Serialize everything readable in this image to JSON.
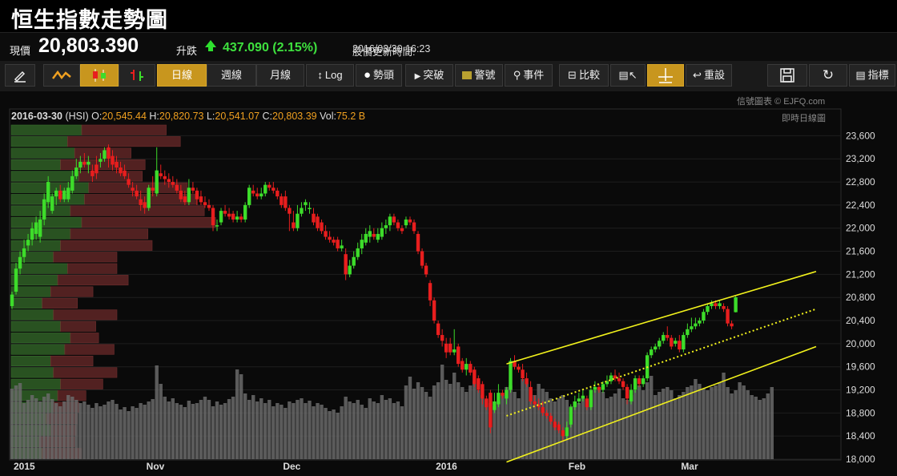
{
  "title": "恒生指數走勢圖",
  "quote": {
    "price_label": "現價",
    "price": "20,803.390",
    "change_label": "升跌",
    "change": "437.090 (2.15%)",
    "update_label": "股價更新時間:",
    "update_time": "2016/03/30 16:23"
  },
  "toolbar": {
    "daily": "日線",
    "weekly": "週線",
    "monthly": "月線",
    "log": "Log",
    "trend": "勢頭",
    "breakout": "突破",
    "alert": "警號",
    "events": "事件",
    "compare": "比較",
    "reset": "重設",
    "indicators": "指標"
  },
  "credit": "信號圖表 © EJFQ.com",
  "realtime_label": "即時日線圖",
  "ohlc": {
    "date": "2016-03-30",
    "symbol": "(HSI)",
    "o_label": "O:",
    "o": "20,545.44",
    "h_label": "H:",
    "h": "20,820.73",
    "l_label": "L:",
    "l": "20,541.07",
    "c_label": "C:",
    "c": "20,803.39",
    "vol_label": "Vol:",
    "vol": "75.2 B"
  },
  "colors": {
    "up": "#3ddc2a",
    "down": "#e81e1e",
    "volume": "#6a6a6a",
    "channel": "#f2f21c",
    "vp_up": "#2d5a24",
    "vp_down": "#5a2424"
  },
  "chart_data": {
    "type": "candlestick",
    "y_range": [
      18000,
      23800
    ],
    "y_ticks": [
      "23,600",
      "23,200",
      "22,800",
      "22,400",
      "22,000",
      "21,600",
      "21,200",
      "20,800",
      "20,400",
      "20,000",
      "19,600",
      "19,200",
      "18,800",
      "18,400",
      "18,000"
    ],
    "x_labels": [
      {
        "label": "2015",
        "i": 0
      },
      {
        "label": "Nov",
        "i": 33
      },
      {
        "label": "Dec",
        "i": 67
      },
      {
        "label": "2016",
        "i": 105
      },
      {
        "label": "Feb",
        "i": 138
      },
      {
        "label": "Mar",
        "i": 166
      }
    ],
    "candles": [
      [
        20650,
        20850,
        20900,
        20600
      ],
      [
        20900,
        21300,
        21400,
        20850
      ],
      [
        21300,
        21500,
        21600,
        21200
      ],
      [
        21500,
        21650,
        21800,
        21400
      ],
      [
        21700,
        21800,
        21900,
        21600
      ],
      [
        21800,
        22000,
        22100,
        21700
      ],
      [
        21900,
        22100,
        22200,
        21800
      ],
      [
        21850,
        22150,
        22300,
        21750
      ],
      [
        22150,
        22500,
        22600,
        22050
      ],
      [
        22450,
        22800,
        22900,
        22350
      ],
      [
        22300,
        22550,
        22600,
        22250
      ],
      [
        22550,
        22650,
        22700,
        22400
      ],
      [
        22650,
        22500,
        22750,
        22450
      ],
      [
        22500,
        22650,
        22700,
        22450
      ],
      [
        22500,
        22700,
        22800,
        22450
      ],
      [
        22650,
        22900,
        23000,
        22600
      ],
      [
        22900,
        23050,
        23200,
        22850
      ],
      [
        23050,
        23150,
        23250,
        22950
      ],
      [
        23150,
        23100,
        23300,
        23050
      ],
      [
        23100,
        23150,
        23250,
        22950
      ],
      [
        23000,
        22900,
        23100,
        22800
      ],
      [
        23100,
        22950,
        23250,
        22850
      ],
      [
        23150,
        23200,
        23300,
        23050
      ],
      [
        23200,
        23350,
        23400,
        23150
      ],
      [
        23400,
        23200,
        23450,
        23050
      ],
      [
        23250,
        23100,
        23350,
        23000
      ],
      [
        23150,
        23050,
        23250,
        22950
      ],
      [
        23050,
        22950,
        23150,
        22900
      ],
      [
        23000,
        22900,
        23100,
        22850
      ],
      [
        22850,
        22750,
        22950,
        22700
      ],
      [
        22700,
        22650,
        22800,
        22550
      ],
      [
        22650,
        22550,
        22750,
        22500
      ],
      [
        22500,
        22400,
        22650,
        22300
      ],
      [
        22450,
        22350,
        22550,
        22250
      ],
      [
        22350,
        22700,
        22750,
        22300
      ],
      [
        22700,
        22650,
        22900,
        22550
      ],
      [
        22600,
        23000,
        23400,
        22550
      ],
      [
        22950,
        22900,
        23100,
        22850
      ],
      [
        22900,
        22850,
        23000,
        22750
      ],
      [
        22850,
        22800,
        22950,
        22700
      ],
      [
        22800,
        22750,
        22900,
        22700
      ],
      [
        22750,
        22650,
        22850,
        22600
      ],
      [
        22650,
        22500,
        22750,
        22450
      ],
      [
        22550,
        22450,
        22650,
        22400
      ],
      [
        22450,
        22700,
        22850,
        22400
      ],
      [
        22700,
        22650,
        22800,
        22600
      ],
      [
        22650,
        22500,
        22700,
        22400
      ],
      [
        22550,
        22450,
        22650,
        22400
      ],
      [
        22450,
        22400,
        22550,
        22350
      ],
      [
        22400,
        22350,
        22500,
        22300
      ],
      [
        22350,
        22050,
        22400,
        21950
      ],
      [
        22050,
        22050,
        22150,
        21950
      ],
      [
        22100,
        22300,
        22350,
        22050
      ],
      [
        22300,
        22250,
        22400,
        22200
      ],
      [
        22250,
        22200,
        22350,
        22150
      ],
      [
        22250,
        22150,
        22300,
        22100
      ],
      [
        22150,
        22200,
        22300,
        22100
      ],
      [
        22200,
        22150,
        22250,
        22100
      ],
      [
        22150,
        22400,
        22450,
        22100
      ],
      [
        22400,
        22700,
        22750,
        22350
      ],
      [
        22650,
        22600,
        22750,
        22550
      ],
      [
        22600,
        22550,
        22700,
        22500
      ],
      [
        22550,
        22600,
        22700,
        22500
      ],
      [
        22600,
        22750,
        22800,
        22550
      ],
      [
        22750,
        22700,
        22800,
        22650
      ],
      [
        22700,
        22650,
        22800,
        22600
      ],
      [
        22650,
        22550,
        22700,
        22500
      ],
      [
        22550,
        22400,
        22600,
        22350
      ],
      [
        22550,
        22350,
        22650,
        22300
      ],
      [
        22350,
        22250,
        22400,
        21950
      ],
      [
        22100,
        22000,
        22300,
        21950
      ],
      [
        22000,
        22250,
        22400,
        21950
      ],
      [
        22250,
        22350,
        22450,
        22200
      ],
      [
        22400,
        22450,
        22500,
        22300
      ],
      [
        22350,
        22350,
        22450,
        22250
      ],
      [
        22250,
        22100,
        22350,
        22050
      ],
      [
        22200,
        22000,
        22250,
        21950
      ],
      [
        22100,
        21950,
        22150,
        21900
      ],
      [
        21950,
        21850,
        22050,
        21800
      ],
      [
        21850,
        21800,
        21950,
        21750
      ],
      [
        21800,
        21750,
        21850,
        21700
      ],
      [
        21800,
        21650,
        21850,
        21600
      ],
      [
        21650,
        21700,
        21800,
        21600
      ],
      [
        21550,
        21200,
        21650,
        21100
      ],
      [
        21200,
        21350,
        21450,
        21150
      ],
      [
        21350,
        21500,
        21600,
        21300
      ],
      [
        21500,
        21650,
        21750,
        21450
      ],
      [
        21650,
        21800,
        21900,
        21550
      ],
      [
        21750,
        21900,
        22000,
        21700
      ],
      [
        21850,
        21950,
        22050,
        21750
      ],
      [
        21900,
        21850,
        22000,
        21800
      ],
      [
        21800,
        21900,
        22000,
        21750
      ],
      [
        21850,
        22000,
        22100,
        21800
      ],
      [
        22000,
        22050,
        22150,
        21900
      ],
      [
        22050,
        22200,
        22250,
        21950
      ],
      [
        22200,
        22100,
        22250,
        22050
      ],
      [
        22100,
        22000,
        22150,
        21950
      ],
      [
        22000,
        21950,
        22050,
        21900
      ],
      [
        22050,
        22150,
        22200,
        22000
      ],
      [
        22150,
        22100,
        22200,
        22050
      ],
      [
        22100,
        21950,
        22150,
        21900
      ],
      [
        21900,
        21600,
        21950,
        21550
      ],
      [
        21600,
        21350,
        21650,
        21300
      ],
      [
        21350,
        21200,
        21400,
        21150
      ],
      [
        21050,
        20750,
        21100,
        20650
      ],
      [
        20750,
        20400,
        20800,
        20350
      ],
      [
        20350,
        20150,
        20400,
        20100
      ],
      [
        20150,
        20050,
        20250,
        19950
      ],
      [
        20000,
        19850,
        20100,
        19750
      ],
      [
        20000,
        19850,
        20100,
        19800
      ],
      [
        19850,
        19900,
        20250,
        19800
      ],
      [
        19950,
        19650,
        20000,
        19600
      ],
      [
        19700,
        19550,
        19750,
        19500
      ],
      [
        19550,
        19650,
        19750,
        19450
      ],
      [
        19650,
        19500,
        19700,
        19450
      ],
      [
        19550,
        19300,
        19600,
        19250
      ],
      [
        19400,
        19200,
        19450,
        19150
      ],
      [
        19300,
        19050,
        19350,
        18950
      ],
      [
        19050,
        18900,
        19100,
        18850
      ],
      [
        19150,
        18550,
        19200,
        18450
      ],
      [
        18850,
        19000,
        19150,
        18800
      ],
      [
        18950,
        19150,
        19300,
        18900
      ],
      [
        19150,
        19100,
        19200,
        19050
      ],
      [
        19050,
        19200,
        19250,
        18950
      ],
      [
        19200,
        19700,
        19750,
        19150
      ],
      [
        19700,
        19600,
        19800,
        19550
      ],
      [
        19600,
        19550,
        19650,
        19500
      ],
      [
        19550,
        19400,
        19650,
        19350
      ],
      [
        19400,
        19300,
        19500,
        19250
      ],
      [
        19250,
        19000,
        19350,
        18950
      ],
      [
        19000,
        18950,
        19100,
        18900
      ],
      [
        18950,
        18900,
        19050,
        18850
      ],
      [
        18900,
        18800,
        19000,
        18750
      ],
      [
        18800,
        18750,
        18850,
        18700
      ],
      [
        18750,
        18650,
        18800,
        18600
      ],
      [
        18650,
        18550,
        18700,
        18500
      ],
      [
        18600,
        18500,
        18650,
        18450
      ],
      [
        18500,
        18400,
        18550,
        18300
      ],
      [
        18400,
        18550,
        18650,
        18350
      ],
      [
        18600,
        18900,
        18950,
        18550
      ],
      [
        18900,
        19000,
        19100,
        18850
      ],
      [
        19000,
        19050,
        19150,
        18950
      ],
      [
        19050,
        19100,
        19200,
        19000
      ],
      [
        19050,
        18900,
        19100,
        18850
      ],
      [
        18900,
        19200,
        19250,
        18850
      ],
      [
        19200,
        19250,
        19350,
        19150
      ],
      [
        19250,
        19200,
        19300,
        19150
      ],
      [
        19200,
        19300,
        19350,
        19150
      ],
      [
        19300,
        19350,
        19450,
        19250
      ],
      [
        19350,
        19450,
        19500,
        19300
      ],
      [
        19450,
        19400,
        19550,
        19350
      ],
      [
        19400,
        19350,
        19500,
        19300
      ],
      [
        19350,
        19250,
        19400,
        19200
      ],
      [
        19250,
        19050,
        19300,
        18950
      ],
      [
        19000,
        19200,
        19300,
        18950
      ],
      [
        19200,
        19400,
        19450,
        19150
      ],
      [
        19400,
        19300,
        19450,
        19250
      ],
      [
        19300,
        19400,
        19450,
        19250
      ],
      [
        19400,
        19800,
        19850,
        19350
      ],
      [
        19800,
        19900,
        19950,
        19750
      ],
      [
        19900,
        19950,
        20000,
        19850
      ],
      [
        19950,
        20050,
        20100,
        19900
      ],
      [
        20050,
        20150,
        20200,
        20000
      ],
      [
        20150,
        20100,
        20300,
        20050
      ],
      [
        20100,
        19950,
        20150,
        19900
      ],
      [
        20000,
        20050,
        20100,
        19950
      ],
      [
        20050,
        19900,
        20150,
        19850
      ],
      [
        19900,
        20150,
        20200,
        19850
      ],
      [
        20150,
        20250,
        20350,
        20100
      ],
      [
        20250,
        20300,
        20450,
        20200
      ],
      [
        20300,
        20350,
        20450,
        20250
      ],
      [
        20350,
        20400,
        20450,
        20300
      ],
      [
        20400,
        20550,
        20600,
        20350
      ],
      [
        20550,
        20650,
        20700,
        20500
      ],
      [
        20650,
        20700,
        20750,
        20600
      ],
      [
        20700,
        20650,
        20750,
        20600
      ],
      [
        20650,
        20700,
        20750,
        20600
      ],
      [
        20650,
        20600,
        20700,
        20550
      ],
      [
        20600,
        20350,
        20650,
        20300
      ],
      [
        20350,
        20300,
        20400,
        20250
      ],
      [
        20545.44,
        20803.39,
        20820.73,
        20541.07
      ]
    ],
    "volume": [
      88,
      92,
      95,
      70,
      74,
      80,
      76,
      72,
      78,
      82,
      75,
      70,
      66,
      72,
      80,
      78,
      74,
      70,
      72,
      68,
      64,
      70,
      66,
      68,
      72,
      74,
      69,
      62,
      65,
      60,
      66,
      64,
      70,
      68,
      72,
      75,
      117,
      94,
      78,
      72,
      76,
      70,
      68,
      65,
      73,
      69,
      70,
      74,
      78,
      74,
      66,
      72,
      68,
      70,
      75,
      78,
      112,
      106,
      82,
      74,
      80,
      72,
      76,
      70,
      74,
      66,
      70,
      68,
      64,
      72,
      70,
      74,
      76,
      70,
      73,
      66,
      70,
      68,
      64,
      60,
      62,
      58,
      66,
      78,
      72,
      70,
      74,
      68,
      64,
      76,
      72,
      70,
      80,
      74,
      76,
      70,
      72,
      66,
      92,
      103,
      88,
      96,
      90,
      84,
      78,
      92,
      96,
      118,
      99,
      94,
      108,
      96,
      90,
      84,
      92,
      97,
      86,
      80,
      74,
      70,
      66,
      72,
      80,
      90,
      92,
      84,
      76,
      100,
      94,
      86,
      80,
      94,
      88,
      84,
      76,
      72,
      76,
      80,
      74,
      66,
      72,
      70,
      76,
      74,
      80,
      86,
      90,
      84,
      76,
      78,
      82,
      88,
      76,
      74,
      80,
      86,
      92,
      86,
      96,
      104,
      80,
      84,
      88,
      90,
      86,
      76,
      80,
      84,
      90,
      92,
      100,
      94,
      88,
      86,
      90,
      92,
      96,
      108,
      90,
      82,
      86,
      96,
      92,
      86,
      80,
      78,
      74,
      76,
      82,
      90
    ],
    "volume_profile": [
      {
        "up": 0.5,
        "down": 0.6
      },
      {
        "up": 0.4,
        "down": 0.8
      },
      {
        "up": 0.45,
        "down": 0.4
      },
      {
        "up": 0.35,
        "down": 0.6
      },
      {
        "up": 0.48,
        "down": 0.45
      },
      {
        "up": 0.55,
        "down": 0.7
      },
      {
        "up": 0.52,
        "down": 0.8
      },
      {
        "up": 0.42,
        "down": 0.95
      },
      {
        "up": 0.5,
        "down": 0.95
      },
      {
        "up": 0.42,
        "down": 0.55
      },
      {
        "up": 0.35,
        "down": 0.65
      },
      {
        "up": 0.3,
        "down": 0.45
      },
      {
        "up": 0.4,
        "down": 0.35
      },
      {
        "up": 0.33,
        "down": 0.5
      },
      {
        "up": 0.28,
        "down": 0.3
      },
      {
        "up": 0.22,
        "down": 0.25
      },
      {
        "up": 0.3,
        "down": 0.45
      },
      {
        "up": 0.35,
        "down": 0.25
      },
      {
        "up": 0.42,
        "down": 0.2
      },
      {
        "up": 0.38,
        "down": 0.35
      },
      {
        "up": 0.28,
        "down": 0.3
      },
      {
        "up": 0.3,
        "down": 0.45
      },
      {
        "up": 0.35,
        "down": 0.3
      },
      {
        "up": 0.33,
        "down": 0.2
      },
      {
        "up": 0.3,
        "down": 0.18
      },
      {
        "up": 0.25,
        "down": 0.22
      },
      {
        "up": 0.28,
        "down": 0.18
      },
      {
        "up": 0.2,
        "down": 0.25
      },
      {
        "up": 0.22,
        "down": 0.28
      }
    ],
    "channel": {
      "upper": [
        [
          123,
          19650
        ],
        [
          200,
          21250
        ]
      ],
      "middle": [
        [
          123,
          18750
        ],
        [
          200,
          20600
        ]
      ],
      "lower": [
        [
          123,
          17950
        ],
        [
          200,
          19950
        ]
      ]
    }
  }
}
